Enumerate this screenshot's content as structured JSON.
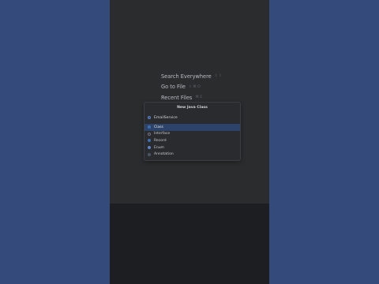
{
  "hints": [
    {
      "label": "Search Everywhere",
      "shortcut": "⇧ ⇧"
    },
    {
      "label": "Go to File",
      "shortcut": "⇧ ⌘ O"
    },
    {
      "label": "Recent Files",
      "shortcut": "⌘ E"
    }
  ],
  "dialog": {
    "title": "New Java Class",
    "name_value": "EmailService",
    "kinds": [
      {
        "label": "Class",
        "icon": "class-icon",
        "selected": true
      },
      {
        "label": "Interface",
        "icon": "interface-icon",
        "selected": false
      },
      {
        "label": "Record",
        "icon": "record-icon",
        "selected": false
      },
      {
        "label": "Enum",
        "icon": "enum-icon",
        "selected": false
      },
      {
        "label": "Annotation",
        "icon": "annotation-icon",
        "selected": false
      }
    ]
  },
  "colors": {
    "outer_background": "#344a7a",
    "editor_background": "#2b2c2e",
    "selection": "#2e4369",
    "accent_blue": "#3f6fb0"
  }
}
